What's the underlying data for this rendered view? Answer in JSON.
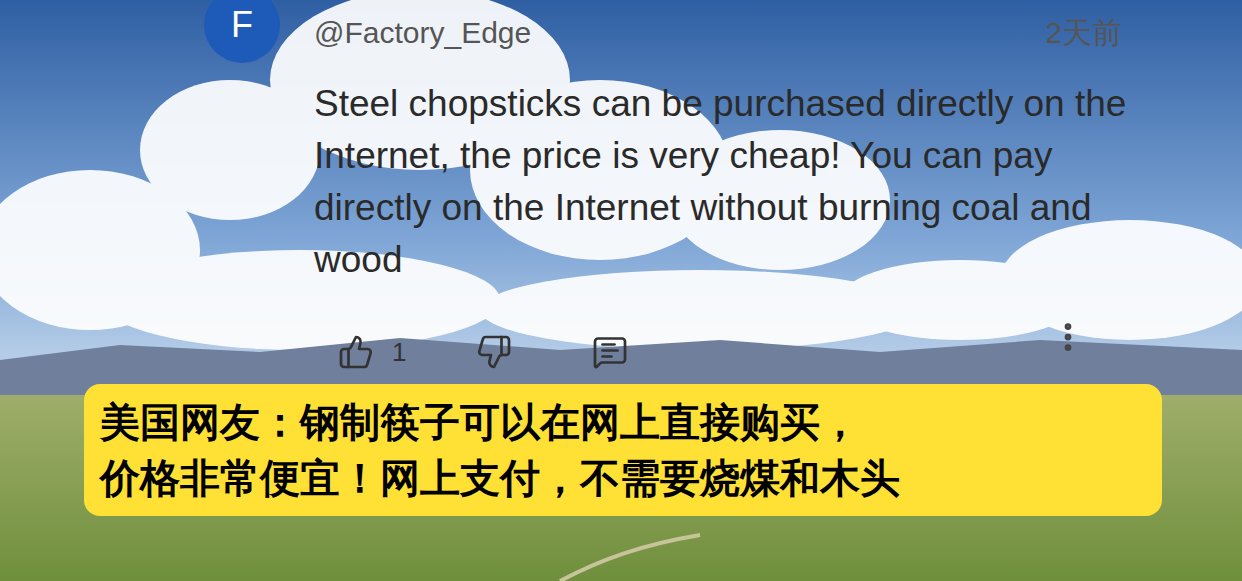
{
  "comment": {
    "avatar": "F",
    "author": "@Factory_Edge",
    "time": "2天前",
    "text": "Steel chopsticks can be purchased directly on the Internet, the price is very cheap! You can pay directly on the Internet without burning coal and wood",
    "likes": "1"
  },
  "caption": {
    "lines": [
      "美国网友：钢制筷子可以在网上直接购买，",
      "价格非常便宜！网上支付，不需要烧煤和木头"
    ]
  }
}
